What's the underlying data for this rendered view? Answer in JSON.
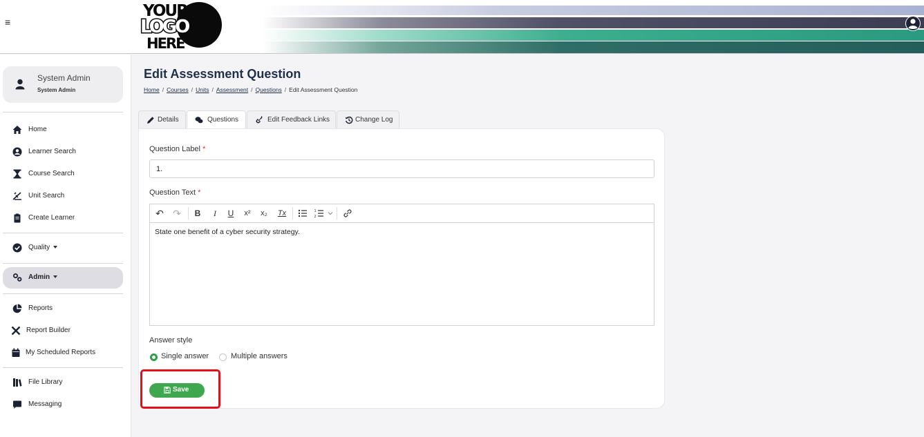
{
  "header": {
    "menu_icon": "hamburger-icon",
    "logo": {
      "line1": "YOUR",
      "line2": "LOGO",
      "line3": "HERE"
    },
    "user_icon": "user-circle-icon"
  },
  "sidebar": {
    "profile": {
      "name": "System Admin",
      "role": "System Admin",
      "icon": "user-icon"
    },
    "items": [
      {
        "label": "Home",
        "icon": "home-icon"
      },
      {
        "label": "Learner Search",
        "icon": "user-circle-icon"
      },
      {
        "label": "Course Search",
        "icon": "hourglass-icon"
      },
      {
        "label": "Unit Search",
        "icon": "ruler-icon"
      },
      {
        "label": "Create Learner",
        "icon": "clipboard-icon"
      },
      {
        "label": "Quality",
        "icon": "check-circle-icon"
      },
      {
        "label": "Admin",
        "icon": "cogs-icon"
      },
      {
        "label": "Reports",
        "icon": "pie-chart-icon"
      },
      {
        "label": "Report Builder",
        "icon": "tools-icon"
      },
      {
        "label": "My Scheduled Reports",
        "icon": "calendar-icon"
      },
      {
        "label": "File Library",
        "icon": "books-icon"
      },
      {
        "label": "Messaging",
        "icon": "message-icon"
      }
    ]
  },
  "page": {
    "title": "Edit Assessment Question",
    "breadcrumb": [
      "Home",
      "Courses",
      "Units",
      "Assessment",
      "Questions",
      "Edit Assessment Question"
    ],
    "tabs": [
      {
        "label": "Details",
        "icon": "pencil-icon"
      },
      {
        "label": "Questions",
        "icon": "comments-icon"
      },
      {
        "label": "Edit Feedback Links",
        "icon": "link-icon"
      },
      {
        "label": "Change Log",
        "icon": "history-icon"
      }
    ],
    "active_tab": "Questions"
  },
  "form": {
    "question_label": {
      "label": "Question Label",
      "required": "*",
      "value": "1."
    },
    "question_text": {
      "label": "Question Text",
      "required": "*",
      "value": "State one benefit of a cyber security strategy."
    },
    "toolbar": {
      "undo": "↶",
      "redo": "↷",
      "bold": "B",
      "italic": "I",
      "underline": "U",
      "superscript": "x²",
      "subscript": "x₂",
      "clear": "Tx"
    },
    "answer_style": {
      "label": "Answer style",
      "options": [
        "Single answer",
        "Multiple answers"
      ],
      "selected": "Single answer"
    },
    "save_label": "Save"
  },
  "colors": {
    "accent": "#3fa84f",
    "title": "#1f2f4a",
    "highlight": "#e3101a"
  }
}
